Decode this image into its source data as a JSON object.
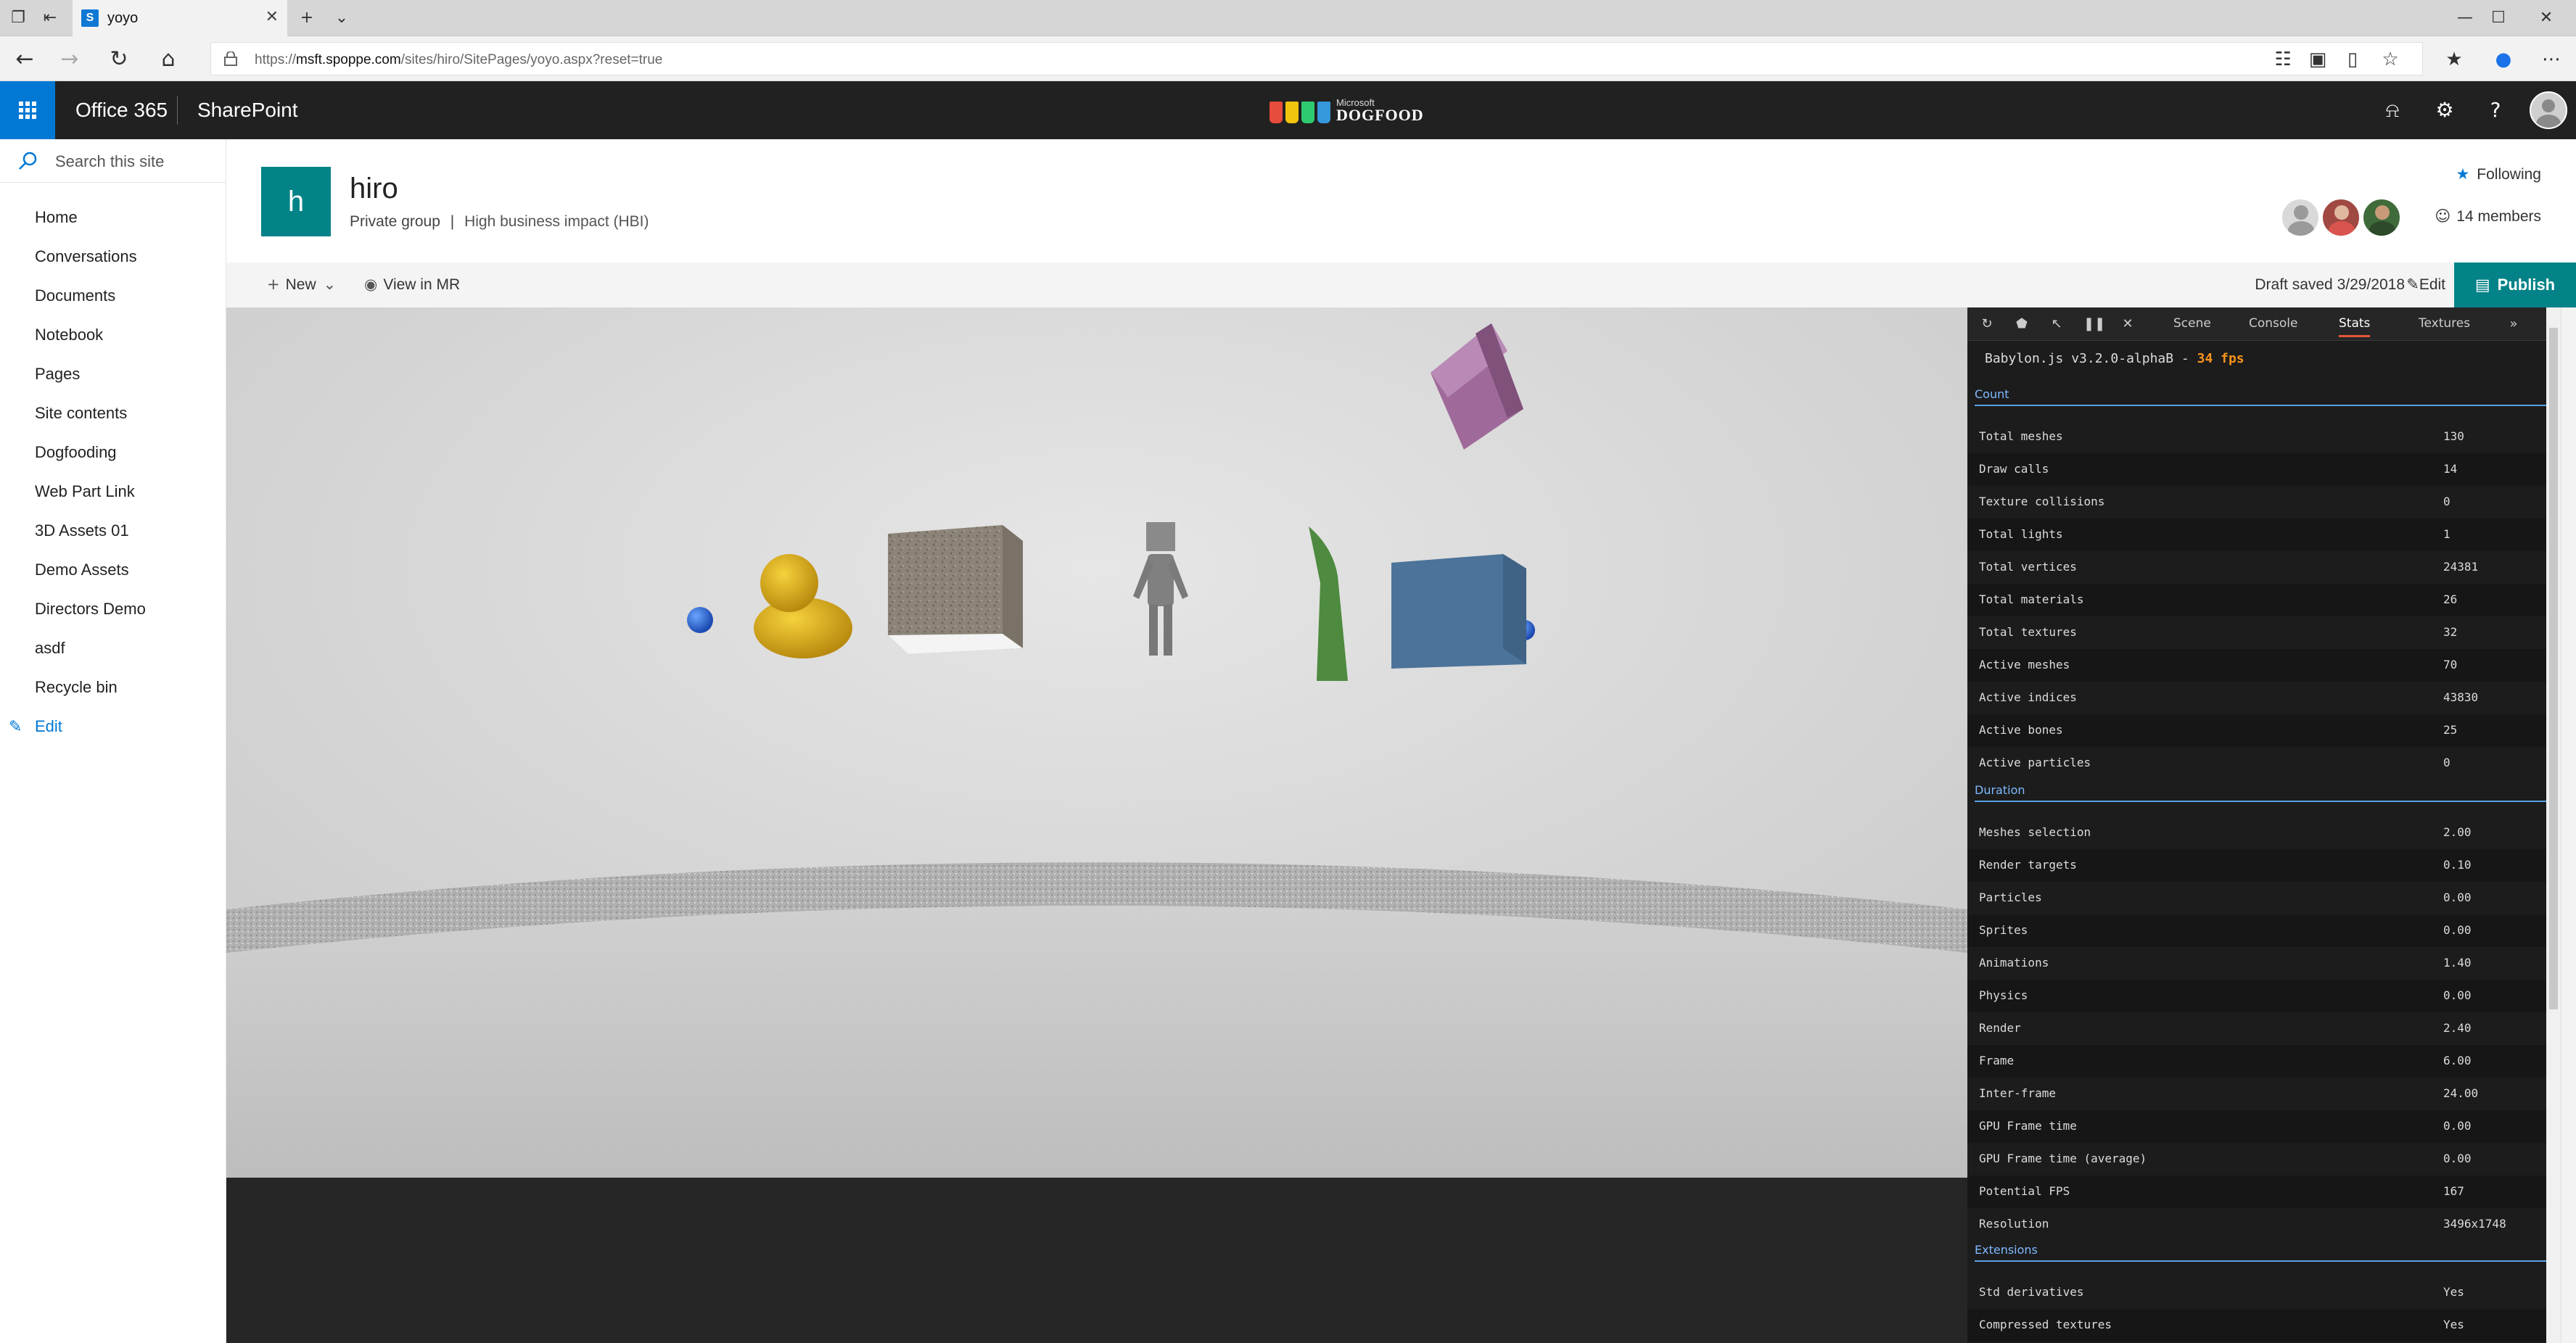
{
  "browser": {
    "tab_title": "yoyo",
    "url_prefix": "https://",
    "url_host": "msft.spoppe.com",
    "url_path": "/sites/hiro/SitePages/yoyo.aspx?reset=true"
  },
  "suite": {
    "app1": "Office 365",
    "app2": "SharePoint",
    "brand_small": "Microsoft",
    "brand_big": "DOGFOOD"
  },
  "nav": {
    "search_placeholder": "Search this site",
    "items": [
      "Home",
      "Conversations",
      "Documents",
      "Notebook",
      "Pages",
      "Site contents",
      "Dogfooding",
      "Web Part Link",
      "3D Assets 01",
      "Demo Assets",
      "Directors Demo",
      "asdf",
      "Recycle bin"
    ],
    "edit_label": "Edit"
  },
  "site": {
    "logo_letter": "h",
    "title": "hiro",
    "group_type": "Private group",
    "separator": "|",
    "classification": "High business impact (HBI)",
    "following_label": "Following",
    "members_label": "14 members"
  },
  "command_bar": {
    "new_label": "New",
    "view_mr_label": "View in MR",
    "draft_status": "Draft saved 3/29/2018",
    "edit_label": "Edit",
    "publish_label": "Publish"
  },
  "debug_panel": {
    "tabs": [
      "Scene",
      "Console",
      "Stats",
      "Textures"
    ],
    "active_tab": "Stats",
    "version": "Babylon.js v3.2.0-alphaB - ",
    "fps": "34 fps",
    "sections": {
      "count": {
        "title": "Count",
        "rows": [
          {
            "label": "Total meshes",
            "value": "130"
          },
          {
            "label": "Draw calls",
            "value": "14"
          },
          {
            "label": "Texture collisions",
            "value": "0"
          },
          {
            "label": "Total lights",
            "value": "1"
          },
          {
            "label": "Total vertices",
            "value": "24381"
          },
          {
            "label": "Total materials",
            "value": "26"
          },
          {
            "label": "Total textures",
            "value": "32"
          },
          {
            "label": "Active meshes",
            "value": "70"
          },
          {
            "label": "Active indices",
            "value": "43830"
          },
          {
            "label": "Active bones",
            "value": "25"
          },
          {
            "label": "Active particles",
            "value": "0"
          }
        ]
      },
      "duration": {
        "title": "Duration",
        "rows": [
          {
            "label": "Meshes selection",
            "value": "2.00"
          },
          {
            "label": "Render targets",
            "value": "0.10"
          },
          {
            "label": "Particles",
            "value": "0.00"
          },
          {
            "label": "Sprites",
            "value": "0.00"
          },
          {
            "label": "Animations",
            "value": "1.40"
          },
          {
            "label": "Physics",
            "value": "0.00"
          },
          {
            "label": "Render",
            "value": "2.40"
          },
          {
            "label": "Frame",
            "value": "6.00"
          },
          {
            "label": "Inter-frame",
            "value": "24.00"
          },
          {
            "label": "GPU Frame time",
            "value": "0.00"
          },
          {
            "label": "GPU Frame time (average)",
            "value": "0.00"
          },
          {
            "label": "Potential FPS",
            "value": "167"
          },
          {
            "label": "Resolution",
            "value": "3496x1748"
          }
        ]
      },
      "extensions": {
        "title": "Extensions",
        "rows": [
          {
            "label": "Std derivatives",
            "value": "Yes"
          },
          {
            "label": "Compressed textures",
            "value": "Yes"
          }
        ]
      }
    }
  },
  "colors": {
    "accent": "#0078d4",
    "site_teal": "#038387",
    "suite_bar": "#212121",
    "fps_orange": "#f7941d"
  }
}
